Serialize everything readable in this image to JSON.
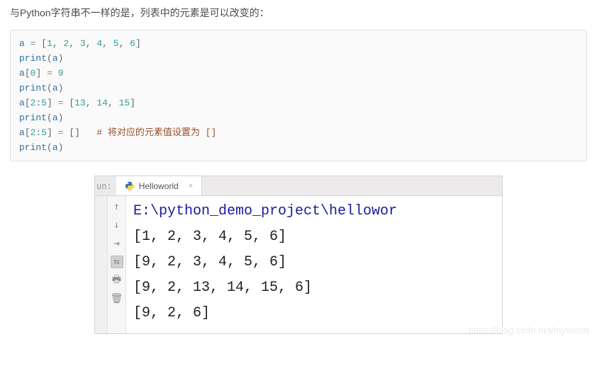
{
  "intro": "与Python字符串不一样的是，列表中的元素是可以改变的：",
  "code": {
    "l1": {
      "v": "a",
      "eq": "=",
      "lb": "[",
      "n1": "1",
      "c": ", ",
      "n2": "2",
      "n3": "3",
      "n4": "4",
      "n5": "5",
      "n6": "6",
      "rb": "]"
    },
    "l2": {
      "f": "print",
      "lp": "(",
      "v": "a",
      "rp": ")"
    },
    "l3": {
      "v": "a",
      "lb": "[",
      "i": "0",
      "rb": "]",
      "eq": "=",
      "val": "9"
    },
    "l4": {
      "f": "print",
      "lp": "(",
      "v": "a",
      "rp": ")"
    },
    "l5": {
      "v": "a",
      "lb": "[",
      "i1": "2",
      "colon": ":",
      "i2": "5",
      "rb": "]",
      "eq": "=",
      "list": "[13, 14, 15]",
      "n1": "13",
      "n2": "14",
      "n3": "15"
    },
    "l6": {
      "f": "print",
      "lp": "(",
      "v": "a",
      "rp": ")"
    },
    "l7": {
      "v": "a",
      "lb": "[",
      "i1": "2",
      "colon": ":",
      "i2": "5",
      "rb": "]",
      "eq": "=",
      "empty": "[]",
      "comment": "# 将对应的元素值设置为 []"
    },
    "l8": {
      "f": "print",
      "lp": "(",
      "v": "a",
      "rp": ")"
    }
  },
  "ide": {
    "run_label": "un:",
    "tab_name": "Helloworld",
    "tab_close": "×",
    "console_path": "E:\\python_demo_project\\hellowor",
    "out1": "[1, 2, 3, 4, 5, 6]",
    "out2": "[9, 2, 3, 4, 5, 6]",
    "out3": "[9, 2, 13, 14, 15, 6]",
    "out4": "[9, 2, 6]"
  },
  "watermark": "https://blog.csdn.net/mysnsds"
}
